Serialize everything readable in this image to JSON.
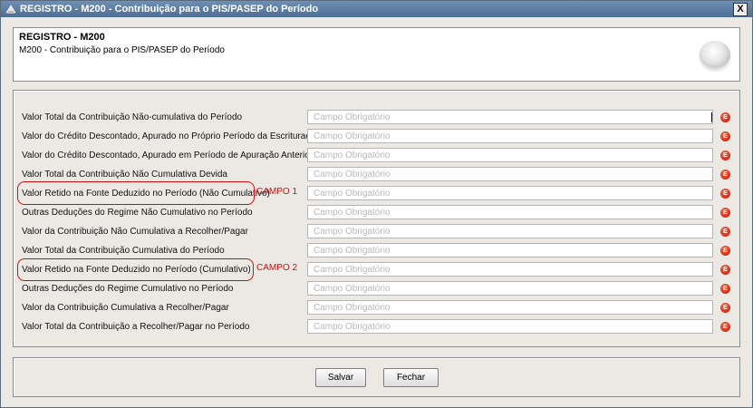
{
  "window": {
    "title": "REGISTRO - M200 - Contribuição para o PIS/PASEP do Período",
    "close_label": "X"
  },
  "header": {
    "title": "REGISTRO - M200",
    "subtitle": "M200 - Contribuição para o PIS/PASEP do Período",
    "logo_icon": "globe-logo-icon"
  },
  "fields": [
    {
      "label": "Valor Total da Contribuição Não-cumulativa do Período",
      "placeholder": "Campo Obrigatório",
      "value": ""
    },
    {
      "label": "Valor do Crédito Descontado, Apurado no Próprio Período da Escrituração",
      "placeholder": "Campo Obrigatório",
      "value": ""
    },
    {
      "label": "Valor do Crédito Descontado, Apurado em Período de Apuração Anterior",
      "placeholder": "Campo Obrigatório",
      "value": ""
    },
    {
      "label": "Valor Total da Contribuição Não Cumulativa Devida",
      "placeholder": "Campo Obrigatório",
      "value": ""
    },
    {
      "label": "Valor Retido na Fonte Deduzido no Período (Não Cumulativo)",
      "placeholder": "Campo Obrigatório",
      "value": ""
    },
    {
      "label": "Outras Deduções do Regime Não Cumulativo no Período",
      "placeholder": "Campo Obrigatório",
      "value": ""
    },
    {
      "label": "Valor da Contribuição Não Cumulativa a Recolher/Pagar",
      "placeholder": "Campo Obrigatório",
      "value": ""
    },
    {
      "label": "Valor Total da Contribuição Cumulativa do Período",
      "placeholder": "Campo Obrigatório",
      "value": ""
    },
    {
      "label": "Valor Retido na Fonte Deduzido no Período (Cumulativo)",
      "placeholder": "Campo Obrigatório",
      "value": ""
    },
    {
      "label": "Outras Deduções do Regime Cumulativo no Período",
      "placeholder": "Campo Obrigatório",
      "value": ""
    },
    {
      "label": "Valor da Contribuição Cumulativa a Recolher/Pagar",
      "placeholder": "Campo Obrigatório",
      "value": ""
    },
    {
      "label": "Valor Total da Contribuição a Recolher/Pagar no Período",
      "placeholder": "Campo Obrigatório",
      "value": ""
    }
  ],
  "required_icon": {
    "name": "required-error-icon",
    "glyph": "E",
    "color": "#d42a10"
  },
  "annotations": {
    "campo1": "CAMPO 1",
    "campo2": "CAMPO 2",
    "color": "#cc1010"
  },
  "buttons": {
    "save": "Salvar",
    "close": "Fechar"
  }
}
